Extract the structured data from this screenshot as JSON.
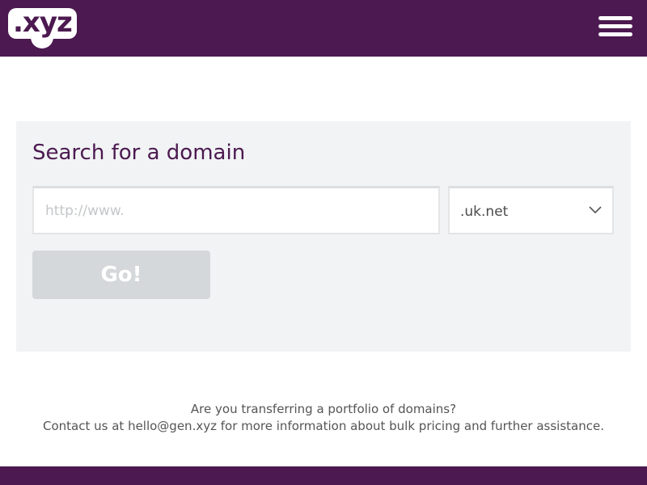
{
  "header": {
    "logo_text": ".xyz",
    "menu_icon": "hamburger-menu-icon",
    "background_color": "#4c1950"
  },
  "search": {
    "title": "Search for a domain",
    "url_placeholder": "http://www.",
    "url_value": "",
    "tld_selected": ".uk.net",
    "go_label": "Go!"
  },
  "info": {
    "line1": "Are you transferring a portfolio of domains?",
    "line2_prefix": "Contact us at",
    "email": "hello@gen.xyz",
    "line2_suffix": "for more information about bulk pricing and further assistance."
  },
  "colors": {
    "brand_purple": "#4c1950",
    "panel_bg": "#f1f3f4",
    "button_disabled": "#d5d8da"
  }
}
